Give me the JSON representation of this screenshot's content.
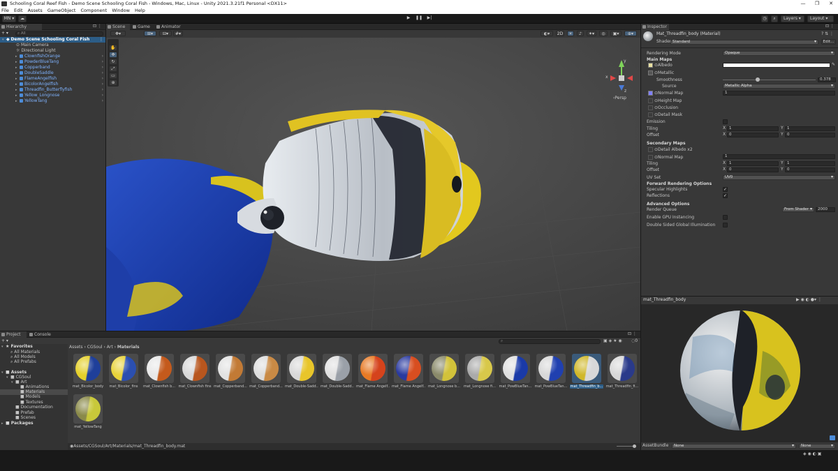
{
  "window": {
    "title": "Schooling Coral Reef Fish - Demo Scene Schooling Coral Fish - Windows, Mac, Linux - Unity 2021.3.21f1 Personal <DX11>"
  },
  "menu": [
    "File",
    "Edit",
    "Assets",
    "GameObject",
    "Component",
    "Window",
    "Help"
  ],
  "toolbar": {
    "account": "MN",
    "layers": "Layers",
    "layout": "Layout"
  },
  "hierarchy": {
    "tab": "Hierarchy",
    "search_placeholder": "All",
    "scene": "Demo Scene Schooling Coral Fish",
    "items": [
      {
        "label": "Main Camera",
        "prefab": false
      },
      {
        "label": "Directional Light",
        "prefab": false
      },
      {
        "label": "ClownfishOrange",
        "prefab": true
      },
      {
        "label": "PowderBlueTang",
        "prefab": true
      },
      {
        "label": "Copperband",
        "prefab": true
      },
      {
        "label": "DoubleSaddle",
        "prefab": true
      },
      {
        "label": "FlameAngelfish",
        "prefab": true
      },
      {
        "label": "BicolorAngelfish",
        "prefab": true
      },
      {
        "label": "Threadfin_Butterflyfish",
        "prefab": true
      },
      {
        "label": "Yellow_Longnose",
        "prefab": true
      },
      {
        "label": "YellowTang",
        "prefab": true
      }
    ]
  },
  "scene_view": {
    "tabs": [
      "Scene",
      "Game",
      "Animator"
    ],
    "toggle_2d": "2D",
    "gizmo_label": "Persp",
    "gizmo_axes": {
      "y": "y",
      "x": "x",
      "z": "z"
    }
  },
  "inspector": {
    "tab": "Inspector",
    "object_name": "Mat_Threadfin_body (Material)",
    "shader_label": "Shader",
    "shader_value": "Standard",
    "edit_label": "Edit...",
    "rendering_mode_label": "Rendering Mode",
    "rendering_mode_value": "Opaque",
    "main_maps": "Main Maps",
    "albedo": "Albedo",
    "metallic": "Metallic",
    "smoothness": "Smoothness",
    "smoothness_value": "0.378",
    "smoothness_fraction": 0.378,
    "source": "Source",
    "source_value": "Metallic Alpha",
    "normal_map": "Normal Map",
    "normal_map_value": "1",
    "height_map": "Height Map",
    "occlusion": "Occlusion",
    "detail_mask": "Detail Mask",
    "emission": "Emission",
    "tiling": "Tiling",
    "offset": "Offset",
    "x": "X",
    "y": "Y",
    "tiling_x": "1",
    "tiling_y": "1",
    "offset_x": "0",
    "offset_y": "0",
    "secondary_maps": "Secondary Maps",
    "detail_albedo": "Detail Albedo x2",
    "normal_map2": "Normal Map",
    "normal_map2_value": "1",
    "tiling2_x": "1",
    "tiling2_y": "1",
    "offset2_x": "0",
    "offset2_y": "0",
    "uv_set": "UV Set",
    "uv_set_value": "UV0",
    "forward_options": "Forward Rendering Options",
    "specular_highlights": "Specular Highlights",
    "reflections": "Reflections",
    "advanced_options": "Advanced Options",
    "render_queue": "Render Queue",
    "render_queue_mode": "From Shader",
    "render_queue_value": "2000",
    "gpu_instancing": "Enable GPU Instancing",
    "double_sided_gi": "Double Sided Global Illumination",
    "preview_title": "mat_Threadfin_body",
    "assetbundle_label": "AssetBundle",
    "assetbundle_value": "None",
    "assetbundle_variant": "None"
  },
  "project": {
    "tabs": [
      "Project",
      "Console"
    ],
    "favorites": "Favorites",
    "fav_items": [
      "All Materials",
      "All Models",
      "All Prefabs"
    ],
    "assets": "Assets",
    "tree": [
      "CGSoul",
      "Art",
      "Animations",
      "Materials",
      "Models",
      "Textures",
      "Documentation",
      "Prefab",
      "Scenes"
    ],
    "packages": "Packages",
    "breadcrumb": [
      "Assets",
      "CGSoul",
      "Art",
      "Materials"
    ],
    "path": "Assets/CGSoul/Art/Materials/mat_Threadfin_body.mat",
    "badge": "0",
    "materials": [
      {
        "label": "mat_Bicolor_body",
        "c1": "#1f3f9a",
        "c2": "#e5d02a"
      },
      {
        "label": "mat_Bicolor_fins",
        "c1": "#2b4fb0",
        "c2": "#e8d33a"
      },
      {
        "label": "mat_Clownfish b...",
        "c1": "#c45a1c",
        "c2": "#e8e8e8"
      },
      {
        "label": "mat_Clownfish fins",
        "c1": "#b8561e",
        "c2": "#d8d8d8"
      },
      {
        "label": "mat_Copperband...",
        "c1": "#c27a35",
        "c2": "#e2e2e2"
      },
      {
        "label": "mat_Copperband...",
        "c1": "#c98a45",
        "c2": "#dddddd"
      },
      {
        "label": "mat_Double-Sadd...",
        "c1": "#e8c52a",
        "c2": "#d8d8d8"
      },
      {
        "label": "mat_Double-Sadd...",
        "c1": "#9aa0a8",
        "c2": "#e0e0e0"
      },
      {
        "label": "mat_Flame Angelf...",
        "c1": "#d5431c",
        "c2": "#e87a25"
      },
      {
        "label": "mat_Flame Angelf...",
        "c1": "#d84e20",
        "c2": "#2a3aa0"
      },
      {
        "label": "mat_Longnose b...",
        "c1": "#d2c23a",
        "c2": "#8a8a6a"
      },
      {
        "label": "mat_Longnose fi...",
        "c1": "#d8c84a",
        "c2": "#aaa"
      },
      {
        "label": "mat_PowBlueTan...",
        "c1": "#1a3aa8",
        "c2": "#e0e0e0"
      },
      {
        "label": "mat_PowBlueTan...",
        "c1": "#2040b0",
        "c2": "#d8d8d8"
      },
      {
        "label": "mat_Threadfin_b...",
        "c1": "#d8d8d8",
        "c2": "#d0b82a",
        "selected": true
      },
      {
        "label": "mat_Threadfin_fi...",
        "c1": "#2a3a8a",
        "c2": "#d8d8d8"
      },
      {
        "label": "mat_YellowTang",
        "c1": "#c8c83a",
        "c2": "#8a8a4a"
      }
    ]
  },
  "colors": {
    "accent": "#2c5d87",
    "prefab": "#7fb3ff",
    "fish_yellow": "#e0c21e",
    "tang_blue": "#1a3fb0"
  }
}
